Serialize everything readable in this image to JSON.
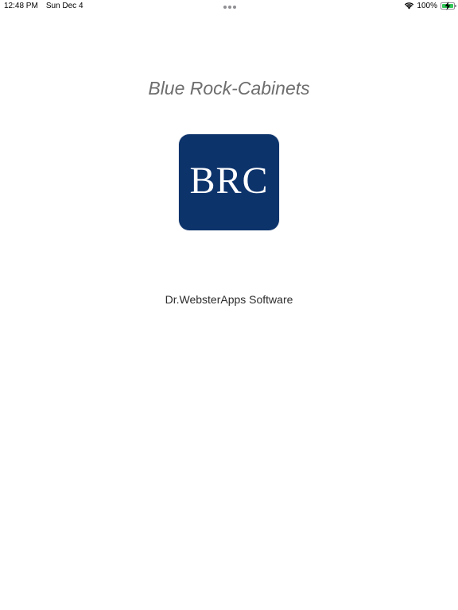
{
  "status_bar": {
    "time": "12:48 PM",
    "date": "Sun Dec 4",
    "battery_percent": "100%",
    "battery_level": 1.0,
    "icons": [
      "wifi-icon",
      "battery-charging-icon"
    ]
  },
  "splash": {
    "title": "Blue Rock-Cabinets",
    "logo_text": "BRC",
    "company": "Dr.WebsterApps Software"
  },
  "colors": {
    "logo_background": "#0d336b",
    "title_text": "#6e6e6e",
    "battery_fill": "#34c759"
  }
}
